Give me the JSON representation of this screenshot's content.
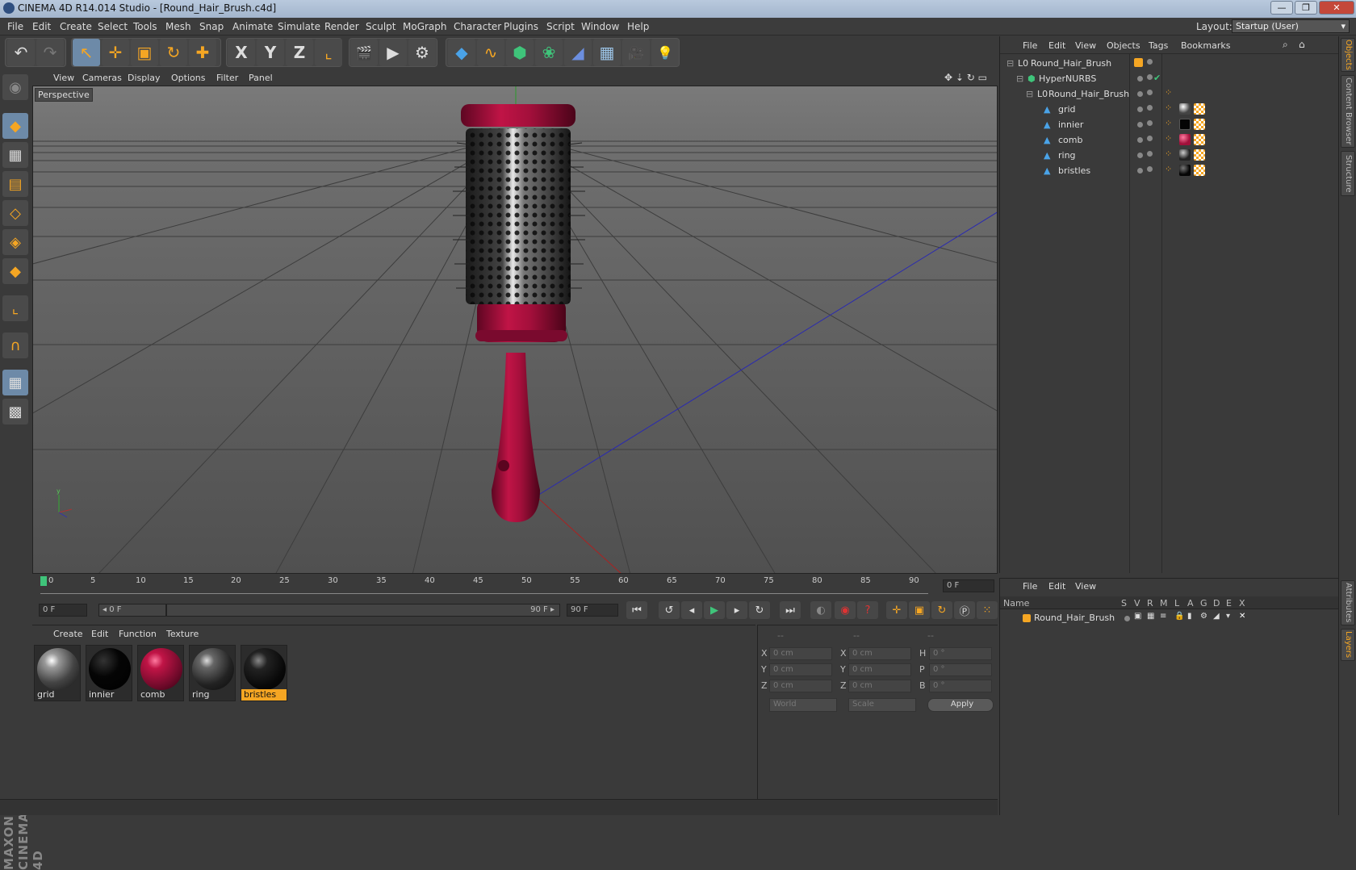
{
  "window": {
    "title": "CINEMA 4D R14.014 Studio - [Round_Hair_Brush.c4d]",
    "min": "—",
    "max": "❐",
    "close": "✕"
  },
  "menu": [
    "File",
    "Edit",
    "Create",
    "Select",
    "Tools",
    "Mesh",
    "Snap",
    "Animate",
    "Simulate",
    "Render",
    "Sculpt",
    "MoGraph",
    "Character",
    "Plugins",
    "Script",
    "Window",
    "Help"
  ],
  "layout": {
    "label": "Layout:",
    "value": "Startup (User)"
  },
  "toolbar": {
    "undo": "↶",
    "redo": "↷",
    "select": "↖",
    "move": "✛",
    "scale": "▣",
    "rotate": "↻",
    "add": "✚",
    "x": "X",
    "y": "Y",
    "z": "Z",
    "coord": "⌞",
    "render1": "🎬",
    "render2": "▶",
    "render3": "⚙",
    "cube": "◆",
    "spline": "∿",
    "nurbs": "⬢",
    "array": "❀",
    "deformer": "◢",
    "floor": "▦",
    "camera": "🎥",
    "light": "💡"
  },
  "viewport": {
    "menu": [
      "View",
      "Cameras",
      "Display",
      "Options",
      "Filter",
      "Panel"
    ],
    "label": "Perspective",
    "nav": "✥ ⇣ ↻ ▭"
  },
  "timeline": {
    "ticks": [
      "0",
      "5",
      "10",
      "15",
      "20",
      "25",
      "30",
      "35",
      "40",
      "45",
      "50",
      "55",
      "60",
      "65",
      "70",
      "75",
      "80",
      "85",
      "90"
    ],
    "end_frame": "0 F"
  },
  "transport": {
    "current": "0 F",
    "range_start": "◂ 0 F",
    "range_end": "90 F ▸",
    "max": "90 F"
  },
  "materials": {
    "menu": [
      "Create",
      "Edit",
      "Function",
      "Texture"
    ],
    "items": [
      {
        "name": "grid",
        "color": "#777777"
      },
      {
        "name": "innier",
        "color": "#050505"
      },
      {
        "name": "comb",
        "color": "#a0103a"
      },
      {
        "name": "ring",
        "color": "#444444"
      },
      {
        "name": "bristles",
        "color": "#111111"
      }
    ]
  },
  "coords": {
    "head": [
      "--",
      "--",
      "--"
    ],
    "rows": [
      {
        "a": "X",
        "av": "0 cm",
        "b": "X",
        "bv": "0 cm",
        "c": "H",
        "cv": "0 °"
      },
      {
        "a": "Y",
        "av": "0 cm",
        "b": "Y",
        "bv": "0 cm",
        "c": "P",
        "cv": "0 °"
      },
      {
        "a": "Z",
        "av": "0 cm",
        "b": "Z",
        "bv": "0 cm",
        "c": "B",
        "cv": "0 °"
      }
    ],
    "world": "World",
    "scale": "Scale",
    "apply": "Apply"
  },
  "objects": {
    "menu": [
      "File",
      "Edit",
      "View",
      "Objects",
      "Tags",
      "Bookmarks"
    ],
    "rows": [
      {
        "name": "Round_Hair_Brush",
        "indent": 0,
        "icon": "L0"
      },
      {
        "name": "HyperNURBS",
        "indent": 1,
        "icon": "⬢"
      },
      {
        "name": "Round_Hair_Brush",
        "indent": 2,
        "icon": "L0"
      },
      {
        "name": "grid",
        "indent": 3,
        "icon": "▲"
      },
      {
        "name": "innier",
        "indent": 3,
        "icon": "▲"
      },
      {
        "name": "comb",
        "indent": 3,
        "icon": "▲"
      },
      {
        "name": "ring",
        "indent": 3,
        "icon": "▲"
      },
      {
        "name": "bristles",
        "indent": 3,
        "icon": "▲"
      }
    ],
    "check": "✔"
  },
  "layers": {
    "menu": [
      "File",
      "Edit",
      "View"
    ],
    "cols": [
      "Name",
      "S",
      "V",
      "R",
      "M",
      "L",
      "A",
      "G",
      "D",
      "E",
      "X"
    ],
    "row": "Round_Hair_Brush"
  },
  "sidetabs": [
    "Objects",
    "Content Browser",
    "Structure",
    "Attributes",
    "Layers"
  ],
  "branding": "MAXON CINEMA 4D",
  "colors": {
    "accent": "#f5a623",
    "brush": "#a0103a"
  }
}
